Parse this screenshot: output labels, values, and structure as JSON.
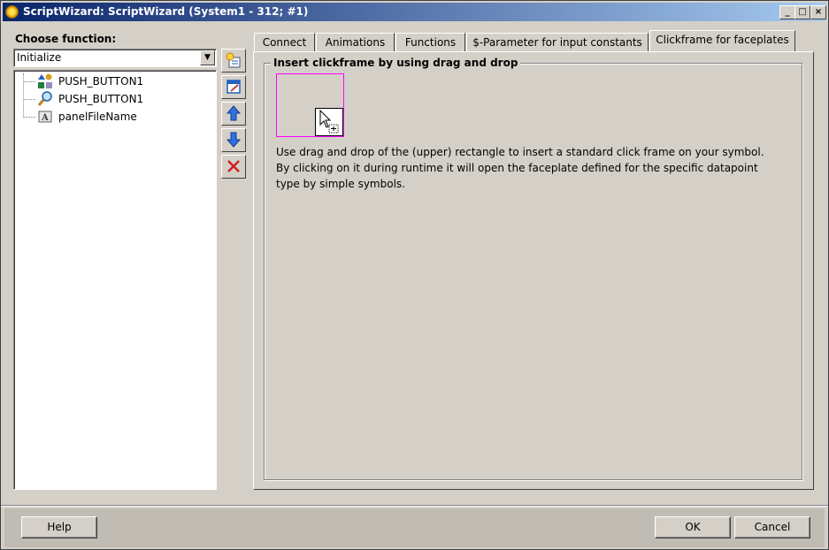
{
  "window": {
    "title": "ScriptWizard: ScriptWizard (System1 - 312; #1)",
    "controls": {
      "minimize": "_",
      "maximize": "□",
      "close": "×"
    }
  },
  "left": {
    "choose_label": "Choose function:",
    "function_select": {
      "value": "Initialize"
    },
    "tree": [
      {
        "label": "PUSH_BUTTON1",
        "icon": "shapes-icon"
      },
      {
        "label": "PUSH_BUTTON1",
        "icon": "magnifier-icon"
      },
      {
        "label": "panelFileName",
        "icon": "text-field-icon"
      }
    ]
  },
  "toolbar": {
    "buttons": [
      {
        "name": "add-script-button",
        "icon": "add-script-icon"
      },
      {
        "name": "edit-script-button",
        "icon": "edit-icon"
      },
      {
        "name": "move-up-button",
        "icon": "arrow-up-icon"
      },
      {
        "name": "move-down-button",
        "icon": "arrow-down-icon"
      },
      {
        "name": "delete-button",
        "icon": "delete-x-icon"
      }
    ]
  },
  "tabs": [
    {
      "label": "Connect",
      "active": false
    },
    {
      "label": "Animations",
      "active": false
    },
    {
      "label": "Functions",
      "active": false
    },
    {
      "label": "$-Parameter for input constants",
      "active": false
    },
    {
      "label": "Clickframe for faceplates",
      "active": true
    }
  ],
  "panel": {
    "group_title": "Insert clickframe by using drag and drop",
    "description": "Use drag and drop of the (upper) rectangle to insert a standard click frame on your symbol. By clicking on it during runtime it will open the faceplate defined for the specific datapoint type by simple symbols.",
    "drag_rect_color": "#ff00ff"
  },
  "footer": {
    "help_label": "Help",
    "ok_label": "OK",
    "cancel_label": "Cancel"
  }
}
